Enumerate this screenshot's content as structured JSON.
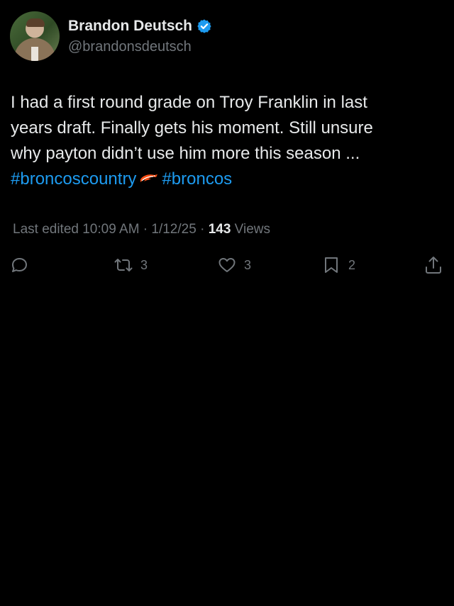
{
  "author": {
    "display_name": "Brandon Deutsch",
    "handle": "@brandonsdeutsch",
    "verified": true,
    "verified_color": "#1d9bf0"
  },
  "post": {
    "line1": "I had a first round grade on Troy Franklin in last",
    "line2": "years draft. Finally gets his moment. Still unsure",
    "line3": "why payton didn’t use him more this season ...",
    "hashtag1": "#broncoscountry",
    "hashtag2": "#broncos",
    "hashtag_color": "#1d9bf0",
    "emoji": "broncos-horse-emoji"
  },
  "meta": {
    "edited_prefix": "Last edited 10:09 AM · 1/12/25 ·",
    "views_count": "143",
    "views_label": "Views"
  },
  "actions": {
    "reply_icon": "reply-icon",
    "repost_icon": "repost-icon",
    "repost_count": "3",
    "like_icon": "heart-icon",
    "like_count": "3",
    "bookmark_icon": "bookmark-icon",
    "bookmark_count": "2",
    "share_icon": "share-icon"
  }
}
